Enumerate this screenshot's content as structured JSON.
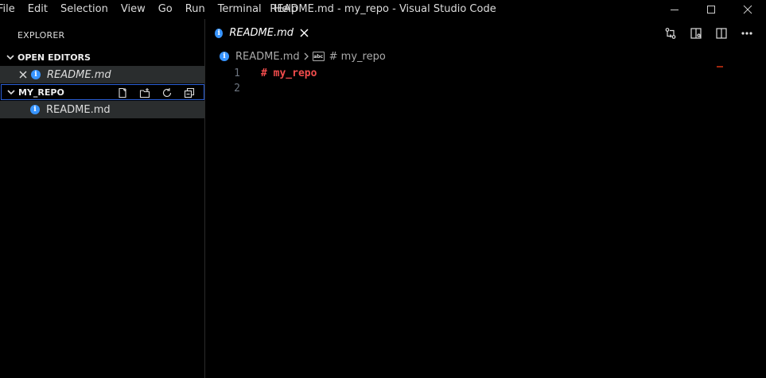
{
  "titlebar": {
    "menu": [
      "File",
      "Edit",
      "Selection",
      "View",
      "Go",
      "Run",
      "Terminal",
      "Help"
    ],
    "title": "README.md - my_repo - Visual Studio Code"
  },
  "sidebar": {
    "title": "EXPLORER",
    "open_editors": {
      "label": "OPEN EDITORS",
      "items": [
        {
          "name": "README.md",
          "icon": "info-icon"
        }
      ]
    },
    "folder": {
      "label": "MY_REPO",
      "actions": [
        "new-file-icon",
        "new-folder-icon",
        "refresh-icon",
        "collapse-all-icon"
      ],
      "files": [
        {
          "name": "README.md",
          "icon": "info-icon"
        }
      ]
    }
  },
  "editor": {
    "tab": {
      "label": "README.md"
    },
    "breadcrumb": {
      "file": "README.md",
      "symbol": "# my_repo"
    },
    "lines": [
      {
        "number": "1",
        "text": "# my_repo"
      },
      {
        "number": "2",
        "text": ""
      }
    ]
  },
  "colors": {
    "accent_blue": "#3794ff",
    "heading_red": "#f14c4c",
    "focus_border": "#2a5fd8"
  }
}
